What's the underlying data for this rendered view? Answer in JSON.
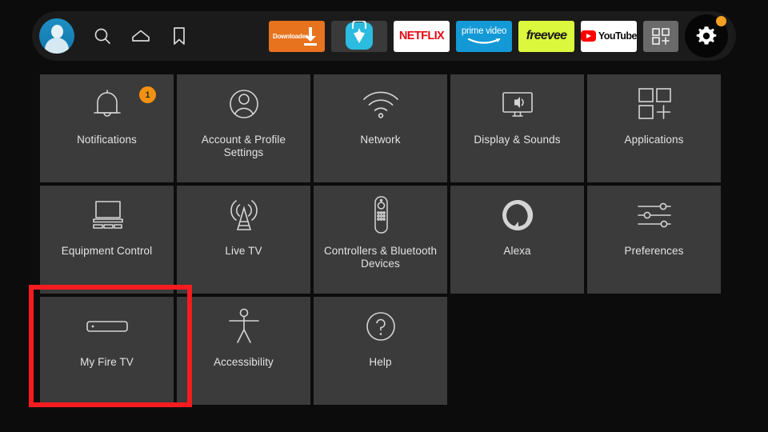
{
  "navbar": {
    "profile": {
      "name": "profile-avatar",
      "label": "Profile"
    },
    "icons": [
      {
        "name": "search-icon",
        "label": "Search"
      },
      {
        "name": "home-icon",
        "label": "Home"
      },
      {
        "name": "bookmark-icon",
        "label": "Watchlist"
      }
    ],
    "apps": [
      {
        "name": "downloader",
        "label": "Downloader",
        "color": "#e8731e"
      },
      {
        "name": "aptoide",
        "label": "",
        "color": "#2bbce0"
      },
      {
        "name": "netflix",
        "label": "NETFLIX",
        "color": "#e50914"
      },
      {
        "name": "prime-video",
        "label": "prime video",
        "color": "#1399d6"
      },
      {
        "name": "freevee",
        "label": "freevee",
        "color": "#dcf83c"
      },
      {
        "name": "youtube",
        "label": "YouTube",
        "color": "#ff0000"
      },
      {
        "name": "all-apps",
        "label": "",
        "color": "#6a6a6a"
      }
    ],
    "settings_button": {
      "label": "Settings",
      "has_notification_dot": true,
      "dot_color": "#f5a020"
    }
  },
  "settings_grid": {
    "rows": [
      [
        {
          "label": "Notifications",
          "icon": "bell-icon",
          "badge": "1"
        },
        {
          "label": "Account & Profile Settings",
          "icon": "person-circle-icon"
        },
        {
          "label": "Network",
          "icon": "wifi-icon"
        },
        {
          "label": "Display & Sounds",
          "icon": "tv-speaker-icon"
        },
        {
          "label": "Applications",
          "icon": "apps-grid-plus-icon"
        }
      ],
      [
        {
          "label": "Equipment Control",
          "icon": "tv-soundbar-icon"
        },
        {
          "label": "Live TV",
          "icon": "broadcast-tower-icon"
        },
        {
          "label": "Controllers & Bluetooth Devices",
          "icon": "remote-control-icon"
        },
        {
          "label": "Alexa",
          "icon": "alexa-ring-icon"
        },
        {
          "label": "Preferences",
          "icon": "sliders-icon"
        }
      ],
      [
        {
          "label": "My Fire TV",
          "icon": "fire-tv-stick-icon",
          "highlighted": true
        },
        {
          "label": "Accessibility",
          "icon": "accessibility-person-icon"
        },
        {
          "label": "Help",
          "icon": "question-circle-icon"
        }
      ]
    ]
  },
  "annotation": {
    "highlight_color": "#f41c20",
    "target": "My Fire TV"
  }
}
